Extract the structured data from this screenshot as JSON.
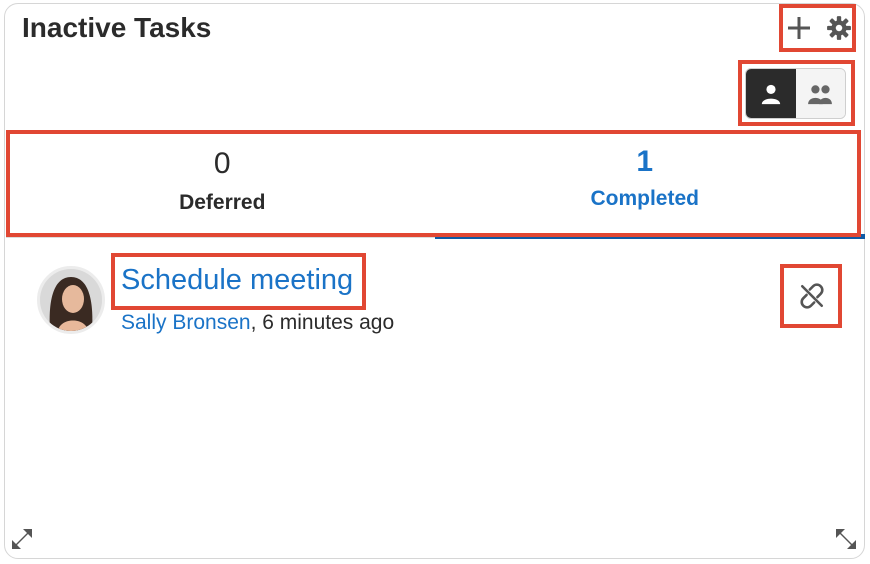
{
  "dashlet": {
    "title": "Inactive Tasks",
    "toolbar": {
      "add_icon": "plus-icon",
      "settings_icon": "gear-icon"
    },
    "filter_toggle": {
      "options": [
        {
          "icon": "single-user-icon",
          "active": true
        },
        {
          "icon": "team-users-icon",
          "active": false
        }
      ]
    },
    "tabs": [
      {
        "count": "0",
        "label": "Deferred",
        "active": false
      },
      {
        "count": "1",
        "label": "Completed",
        "active": true
      }
    ],
    "tasks": [
      {
        "title": "Schedule meeting",
        "assigned_user": "Sally Bronsen",
        "time": ", 6 minutes ago",
        "action_icon": "unlink-icon"
      }
    ],
    "footer": {
      "left_icon": "expand-arrows-icon",
      "right_icon": "resize-arrows-icon"
    },
    "colors": {
      "accent": "#1a73c7",
      "highlight": "#e14733",
      "underline": "#0f5aa5"
    }
  }
}
